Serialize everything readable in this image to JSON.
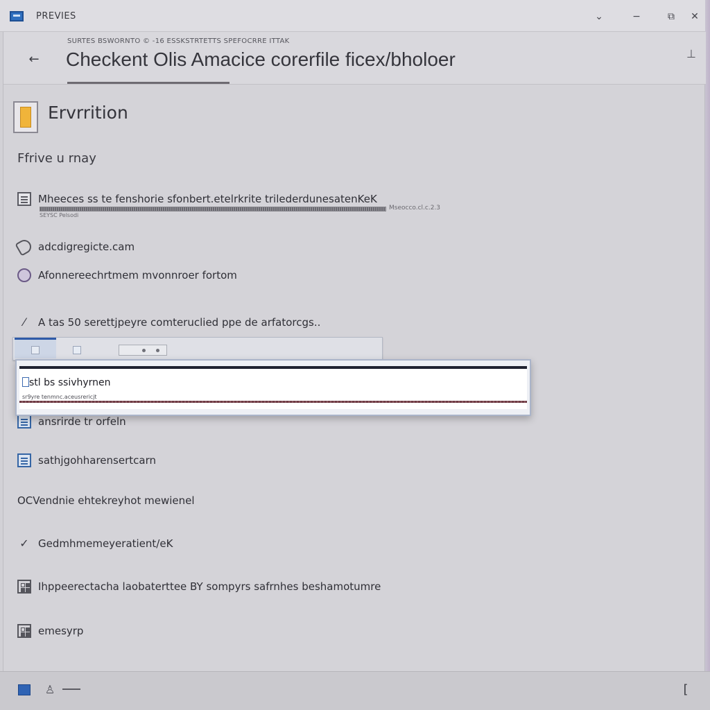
{
  "titlebar": {
    "app_title": "PREVIES",
    "controls": {
      "dropdown": "⌄",
      "minimize": "−",
      "restore": "⧉",
      "close": "✕"
    }
  },
  "header": {
    "breadcrumb": "SURTES BSWORNTO ©  -16      ESSKSTRTETTS SPEFOCRRE    ITTAK",
    "title": "Checkent Olis Amacice corerfile ficex/bholoer",
    "back_icon": "arrow-left-icon",
    "pin_icon": "pin-icon"
  },
  "section": {
    "title": "Ervrrition",
    "subhead": "Ffrive u rnay"
  },
  "items": [
    {
      "icon": "list-icon",
      "label": "Mheeces ss te fenshorie sfonbert.etelrkrite trilederdunesatenKeK"
    },
    {
      "icon": "tag-icon",
      "label": "adcdigregicte.cam"
    },
    {
      "icon": "circle-icon",
      "label": "Afonnereechrtmem mvonnroer fortom"
    },
    {
      "icon": "check-icon",
      "label": "A tas 50 serettjpeyre comteruclied ppe de arfatorcgs.."
    },
    {
      "icon": "doc-icon",
      "label": "ansrirde tr orfeln"
    },
    {
      "icon": "doc-icon",
      "label": "sathjgohharensertcarn"
    },
    {
      "icon": "none",
      "label": "OCVendnie ehtekreyhot mewienel"
    },
    {
      "icon": "check-icon",
      "label": "Gedmhmemeyeratient/eK"
    },
    {
      "icon": "grid-icon",
      "label": "Ihppeerectacha laobaterttee  BY  sompyrs safrnhes beshamotumre"
    },
    {
      "icon": "grid-icon",
      "label": "emesyrp"
    }
  ],
  "progress": {
    "fraction": 1.0,
    "meta": "SEYSC Pelsodi",
    "size": "Mseocco.cl.c.2.3"
  },
  "popup": {
    "value": "stl bs ssivhyrnen",
    "hint": "sr9yre  tenmnc.aceusrericjt"
  },
  "statusbar": {
    "right_glyph": "["
  },
  "colors": {
    "accent": "#2f5aa8",
    "window_bg": "#d4d3d8",
    "titlebar_bg": "#dedde2"
  }
}
